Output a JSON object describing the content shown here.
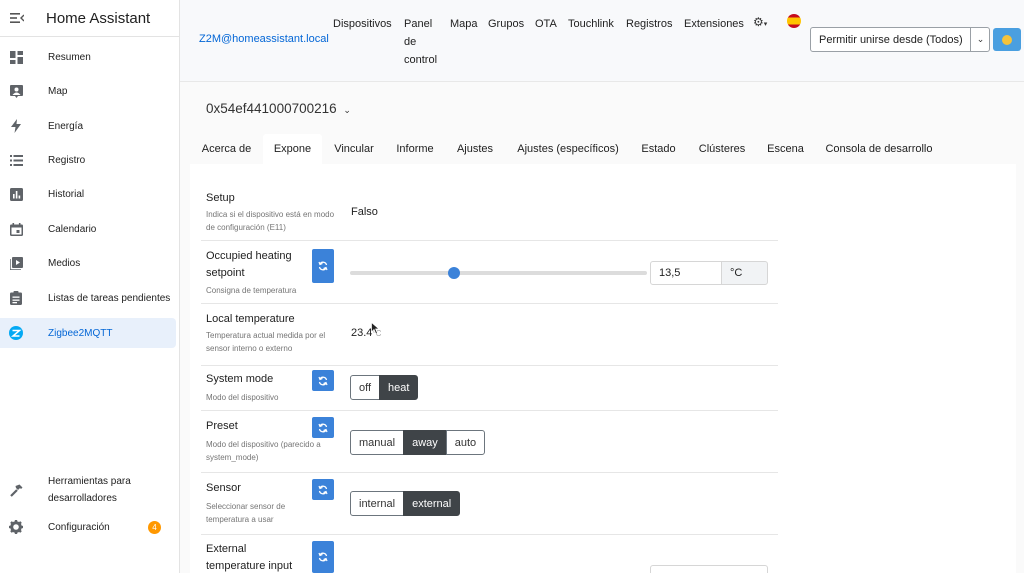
{
  "sidebar": {
    "title": "Home Assistant",
    "items": [
      {
        "label": "Resumen",
        "icon": "dashboard-icon"
      },
      {
        "label": "Map",
        "icon": "map-icon"
      },
      {
        "label": "Energía",
        "icon": "lightning-icon"
      },
      {
        "label": "Registro",
        "icon": "list-icon"
      },
      {
        "label": "Historial",
        "icon": "chart-icon"
      },
      {
        "label": "Calendario",
        "icon": "calendar-icon"
      },
      {
        "label": "Medios",
        "icon": "media-icon"
      },
      {
        "label": "Listas de tareas pendientes",
        "icon": "clipboard-icon"
      },
      {
        "label": "Zigbee2MQTT",
        "icon": "zigbee-icon",
        "active": true
      }
    ],
    "bottom": [
      {
        "label": "Herramientas para desarrolladores",
        "icon": "hammer-icon"
      },
      {
        "label": "Configuración",
        "icon": "gear-icon",
        "badge": "4"
      }
    ]
  },
  "topbar": {
    "brand": "Z2M@homeassistant.local",
    "nav": [
      "Dispositivos",
      "Panel de control",
      "Mapa",
      "Grupos",
      "OTA",
      "Touchlink",
      "Registros",
      "Extensiones"
    ],
    "permit_label": "Permitir unirse desde (Todos)"
  },
  "device": {
    "id": "0x54ef441000700216",
    "tabs": [
      "Acerca de",
      "Expone",
      "Vincular",
      "Informe",
      "Ajustes",
      "Ajustes (específicos)",
      "Estado",
      "Clústeres",
      "Escena",
      "Consola de desarrollo"
    ],
    "active_tab": "Expone"
  },
  "exposes": {
    "setup": {
      "title": "Setup",
      "desc": "Indica si el dispositivo está en modo de configuración (E11)",
      "value": "Falso"
    },
    "heating": {
      "title": "Occupied heating setpoint",
      "desc": "Consigna de temperatura",
      "value": "13,5",
      "unit": "°C",
      "slider_fraction": 0.35
    },
    "local_temp": {
      "title": "Local temperature",
      "desc": "Temperatura actual medida por el sensor interno o externo",
      "value": "23.4",
      "unit": "°C"
    },
    "system_mode": {
      "title": "System mode",
      "desc": "Modo del dispositivo",
      "options": [
        "off",
        "heat"
      ],
      "selected": "heat"
    },
    "preset": {
      "title": "Preset",
      "desc": "Modo del dispositivo (parecido a system_mode)",
      "options": [
        "manual",
        "away",
        "auto"
      ],
      "selected": "away"
    },
    "sensor": {
      "title": "Sensor",
      "desc": "Seleccionar sensor de temperatura a usar",
      "options": [
        "internal",
        "external"
      ],
      "selected": "external"
    },
    "external_input": {
      "title": "External temperature input"
    }
  },
  "colors": {
    "accent": "#3b82d9",
    "active_nav": "#0366d6",
    "badge": "#ff9800",
    "selected_btn": "#3f4448"
  }
}
